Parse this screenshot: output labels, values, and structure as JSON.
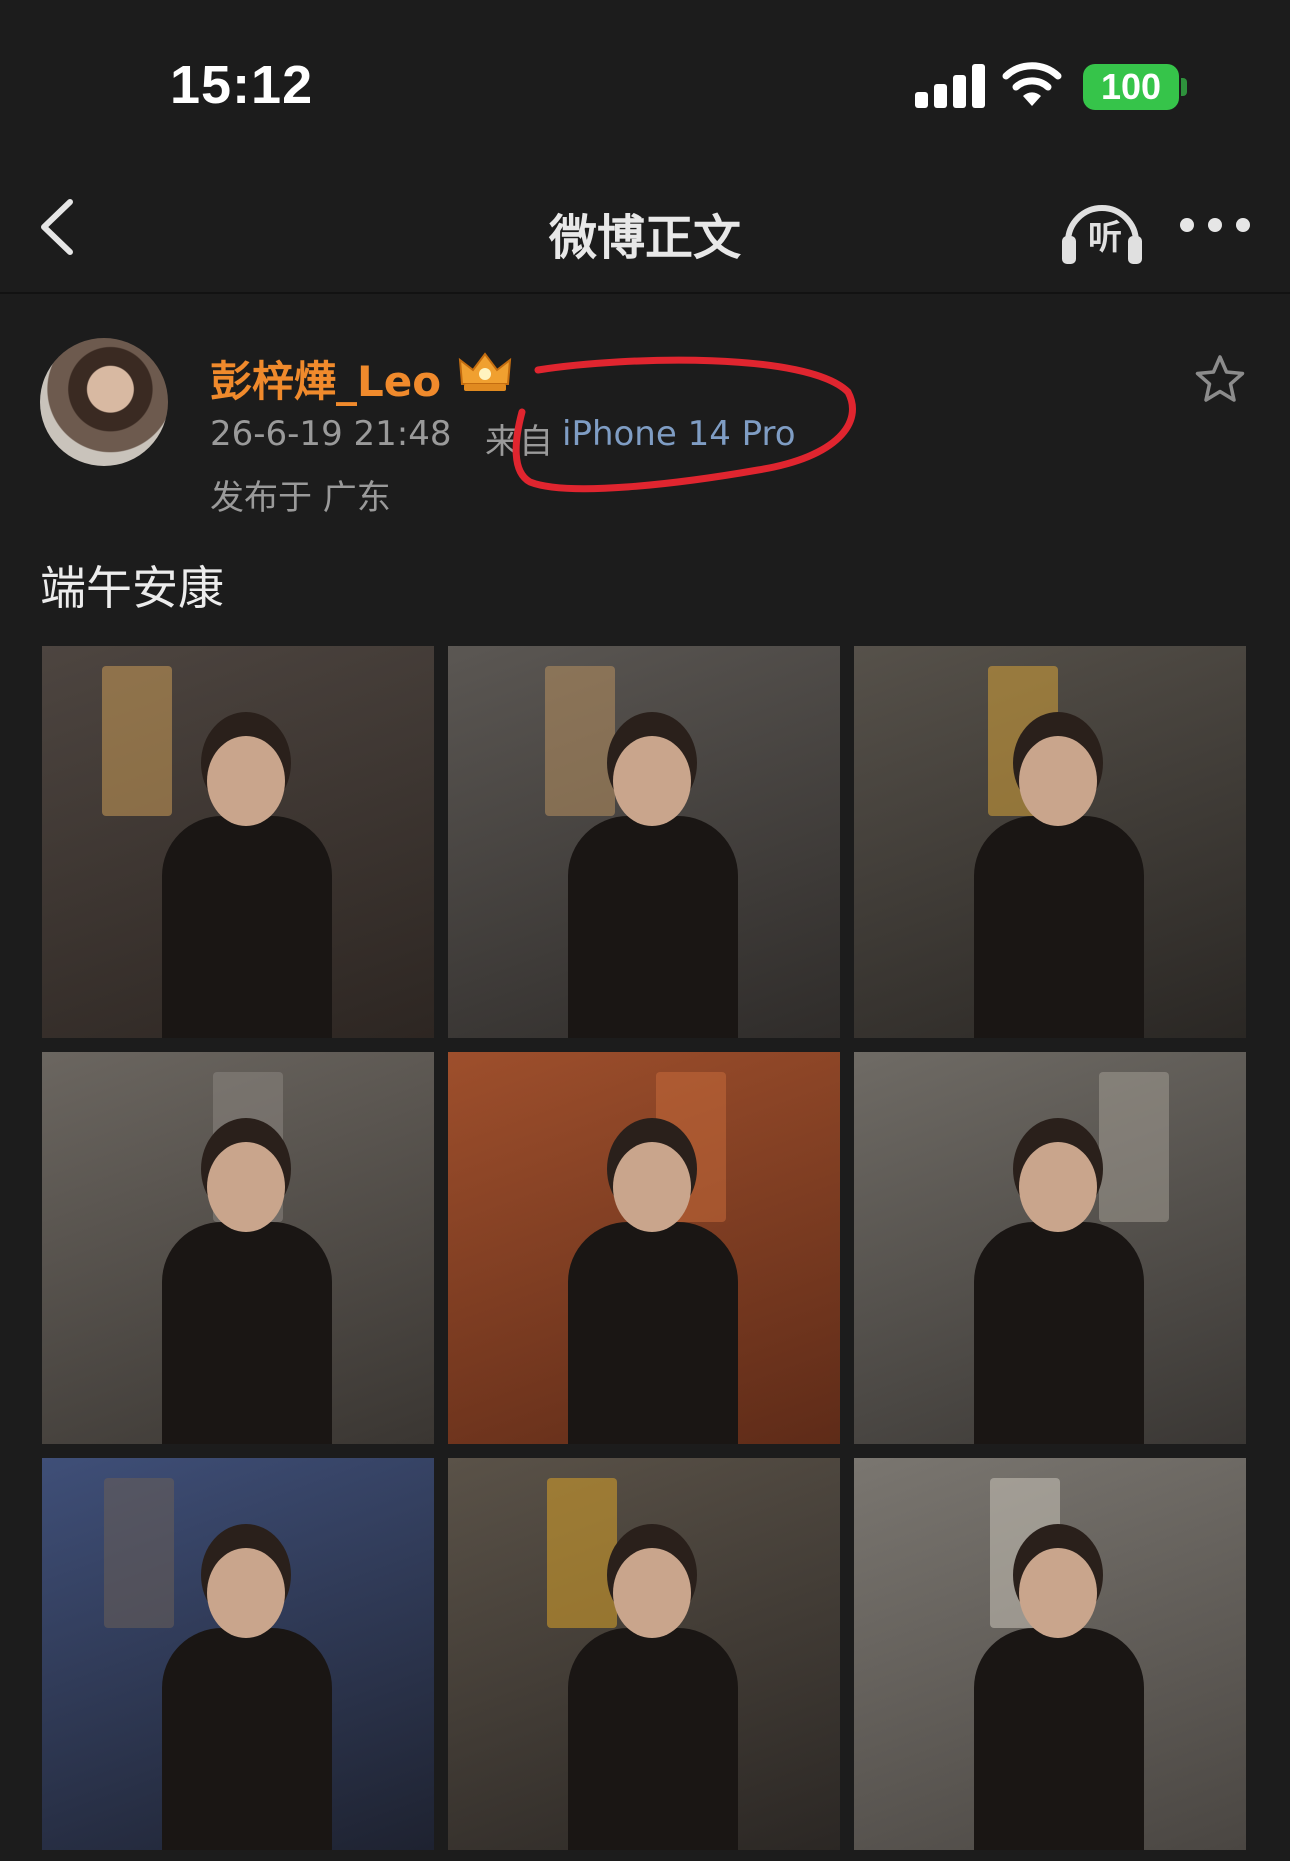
{
  "status_bar": {
    "time": "15:12",
    "battery": "100",
    "signal_icon": "cellular-signal-icon",
    "wifi_icon": "wifi-icon"
  },
  "nav": {
    "title": "微博正文",
    "listen_label": "听",
    "back_icon": "chevron-left-icon",
    "more_icon": "ellipsis-icon"
  },
  "post": {
    "author": "彭梓燁_Leo",
    "time": "26-6-19 21:48",
    "source_prefix": "来自",
    "source_device": "iPhone 14 Pro",
    "location": "发布于 广东",
    "text": "端午安康"
  },
  "photos": [
    {
      "tone": [
        "#4d4540",
        "#2d2622"
      ],
      "accent": "#c89a58"
    },
    {
      "tone": [
        "#5b5753",
        "#2f2c2a"
      ],
      "accent": "#b79060"
    },
    {
      "tone": [
        "#56514a",
        "#2a2724"
      ],
      "accent": "#d6a23a"
    },
    {
      "tone": [
        "#6b6660",
        "#3a3632"
      ],
      "accent": "#8a8580"
    },
    {
      "tone": [
        "#9e4f2c",
        "#5e2b18"
      ],
      "accent": "#c56a3a"
    },
    {
      "tone": [
        "#6f6b65",
        "#3a3734"
      ],
      "accent": "#a09a92"
    },
    {
      "tone": [
        "#3f4f78",
        "#1e2230"
      ],
      "accent": "#6a5f58"
    },
    {
      "tone": [
        "#5a5248",
        "#2b2724"
      ],
      "accent": "#d9a32a"
    },
    {
      "tone": [
        "#7a7670",
        "#4a4642"
      ],
      "accent": "#c8c2b8"
    }
  ],
  "colors": {
    "background": "#1c1c1c",
    "author": "#f08a2c",
    "device": "#7f9dc4",
    "highlight": "#e0252f",
    "battery": "#36c44a"
  }
}
